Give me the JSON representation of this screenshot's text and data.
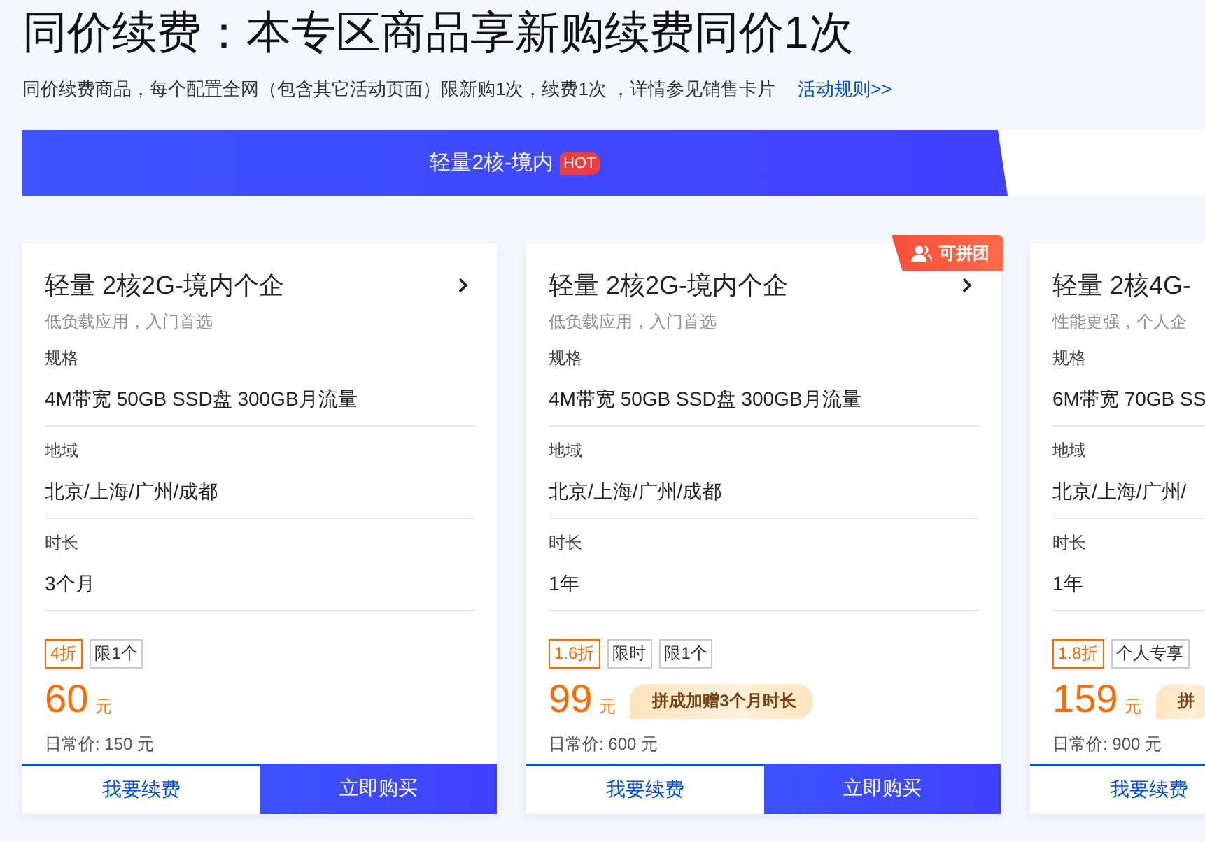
{
  "header": {
    "title": "同价续费：本专区商品享新购续费同价1次",
    "note": "同价续费商品，每个配置全网（包含其它活动页面）限新购1次，续费1次 ，详情参见销售卡片",
    "link": "活动规则>>"
  },
  "tabs": [
    {
      "label": "轻量2核-境内",
      "badge": "HOT",
      "selected": true
    }
  ],
  "cards": [
    {
      "title": "轻量 2核2G-境内个企",
      "more": true,
      "subtitle": "低负载应用，入门首选",
      "specs": [
        {
          "label": "规格",
          "value": "4M带宽 50GB SSD盘 300GB月流量"
        },
        {
          "label": "地域",
          "value": "北京/上海/广州/成都"
        },
        {
          "label": "时长",
          "value": "3个月"
        }
      ],
      "tags": [
        {
          "text": "4折",
          "kind": "discount"
        },
        {
          "text": "限1个",
          "kind": "plain"
        }
      ],
      "price": "60",
      "unit": "元",
      "regular": "日常价: 150 元",
      "renew": "我要续费",
      "buy": "立即购买"
    },
    {
      "title": "轻量 2核2G-境内个企",
      "more": true,
      "group_badge": "可拼团",
      "subtitle": "低负载应用，入门首选",
      "specs": [
        {
          "label": "规格",
          "value": "4M带宽 50GB SSD盘 300GB月流量"
        },
        {
          "label": "地域",
          "value": "北京/上海/广州/成都"
        },
        {
          "label": "时长",
          "value": "1年"
        }
      ],
      "tags": [
        {
          "text": "1.6折",
          "kind": "discount"
        },
        {
          "text": "限时",
          "kind": "plain"
        },
        {
          "text": "限1个",
          "kind": "plain"
        }
      ],
      "price": "99",
      "unit": "元",
      "promo": "拼成加赠3个月时长",
      "regular": "日常价: 600 元",
      "renew": "我要续费",
      "buy": "立即购买"
    },
    {
      "title": "轻量 2核4G-",
      "more": false,
      "subtitle": "性能更强，个人企",
      "specs": [
        {
          "label": "规格",
          "value": "6M带宽 70GB SS"
        },
        {
          "label": "地域",
          "value": "北京/上海/广州/"
        },
        {
          "label": "时长",
          "value": "1年"
        }
      ],
      "tags": [
        {
          "text": "1.8折",
          "kind": "discount"
        },
        {
          "text": "个人专享",
          "kind": "plain"
        }
      ],
      "price": "159",
      "unit": "元",
      "promo": "拼",
      "regular": "日常价: 900 元",
      "renew": "我要续费"
    }
  ]
}
